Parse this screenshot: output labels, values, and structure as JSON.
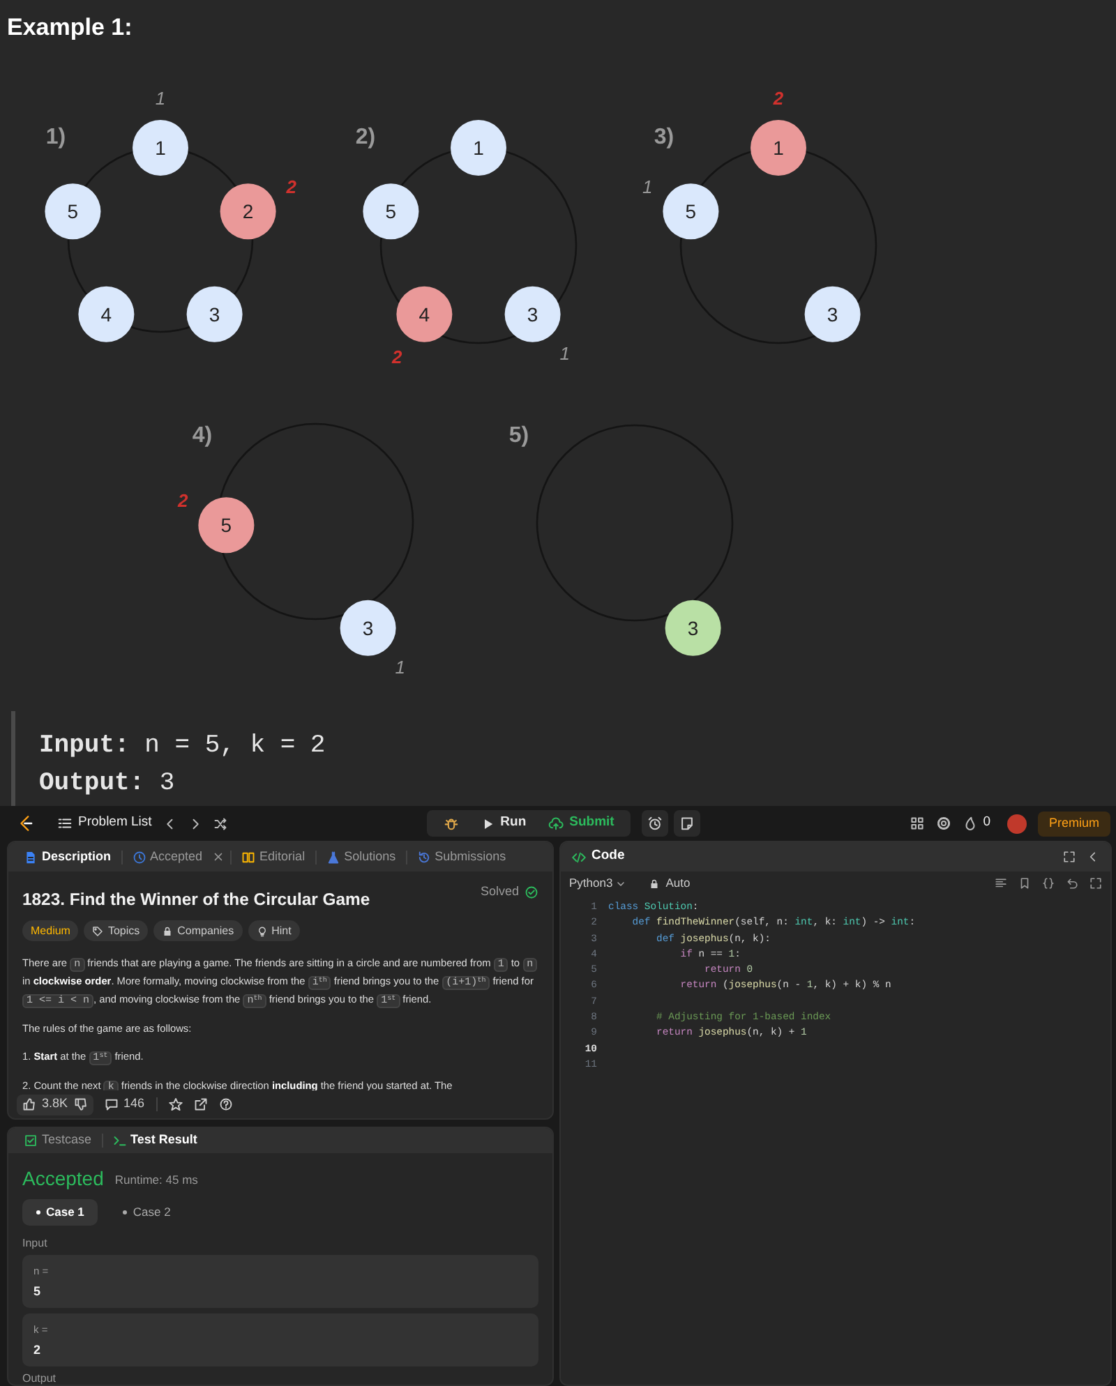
{
  "heading": "Example 1:",
  "diagram": {
    "panels": [
      {
        "label": "1)",
        "nodes": [
          {
            "label": "1",
            "kind": "top",
            "color": "#dae8fc",
            "marker": {
              "text": "1",
              "kind": "start"
            }
          },
          {
            "label": "5",
            "kind": "left",
            "color": "#dae8fc"
          },
          {
            "label": "2",
            "kind": "right",
            "color": "#ea9999",
            "marker": {
              "text": "2",
              "kind": "hit"
            }
          },
          {
            "label": "4",
            "kind": "bottom-left",
            "color": "#dae8fc"
          },
          {
            "label": "3",
            "kind": "bottom-right",
            "color": "#dae8fc"
          }
        ]
      },
      {
        "label": "2)",
        "nodes": [
          {
            "label": "1",
            "kind": "top",
            "color": "#dae8fc"
          },
          {
            "label": "5",
            "kind": "left",
            "color": "#dae8fc"
          },
          {
            "label": "4",
            "kind": "bottom-left",
            "color": "#ea9999",
            "marker": {
              "text": "2",
              "kind": "hit"
            }
          },
          {
            "label": "3",
            "kind": "bottom-right",
            "color": "#dae8fc",
            "marker": {
              "text": "1",
              "kind": "start"
            }
          }
        ]
      },
      {
        "label": "3)",
        "nodes": [
          {
            "label": "1",
            "kind": "top",
            "color": "#ea9999",
            "marker": {
              "text": "2",
              "kind": "hit"
            }
          },
          {
            "label": "5",
            "kind": "left",
            "color": "#dae8fc",
            "marker": {
              "text": "1",
              "kind": "start"
            }
          },
          {
            "label": "3",
            "kind": "bottom-right",
            "color": "#dae8fc"
          }
        ]
      },
      {
        "label": "4)",
        "nodes": [
          {
            "label": "5",
            "kind": "left",
            "color": "#ea9999",
            "marker": {
              "text": "2",
              "kind": "hit"
            }
          },
          {
            "label": "3",
            "kind": "bottom-right",
            "color": "#dae8fc",
            "marker": {
              "text": "1",
              "kind": "start"
            }
          }
        ]
      },
      {
        "label": "5)",
        "nodes": [
          {
            "label": "3",
            "kind": "bottom-right",
            "color": "#b9e0a5"
          }
        ]
      }
    ]
  },
  "example": {
    "input": "**Input:** n = 5, k = 2",
    "output": "**Output:** 3"
  },
  "navbar": {
    "problem_list": "Problem List",
    "run": "Run",
    "submit": "Submit",
    "streak": "0",
    "premium": "Premium"
  },
  "description_tabs": [
    {
      "label": "Description",
      "selected": true,
      "closable": false
    },
    {
      "label": "Accepted",
      "selected": false,
      "closable": true
    },
    {
      "label": "Editorial",
      "selected": false,
      "closable": false
    },
    {
      "label": "Solutions",
      "selected": false,
      "closable": false
    },
    {
      "label": "Submissions",
      "selected": false,
      "closable": false
    }
  ],
  "problem": {
    "title": "1823. Find the Winner of the Circular Game",
    "status": "Solved",
    "tags": [
      {
        "label": "Medium",
        "kind": "difficulty"
      },
      {
        "label": "Topics",
        "kind": "topics"
      },
      {
        "label": "Companies",
        "kind": "companies"
      },
      {
        "label": "Hint",
        "kind": "hint"
      }
    ],
    "paragraphs": [
      [
        "There are ",
        {
          "code": "n"
        },
        " friends that are playing a game. The friends are sitting in a circle and are numbered from ",
        {
          "code": "1"
        },
        " to ",
        {
          "code": "n"
        },
        " in **clockwise order**. More formally, moving clockwise from the ",
        {
          "code": "i$^{th}$"
        },
        " friend brings you to the ",
        {
          "code": "(i+1)$^{th}$"
        },
        " friend for ",
        {
          "code": "1 <= i < n"
        },
        ", and moving clockwise from the ",
        {
          "code": "n$^{th}$"
        },
        " friend brings you to the ",
        {
          "code": "1$^{st}$"
        },
        " friend."
      ],
      [
        "The rules of the game are as follows:"
      ],
      [
        "1. **Start** at the ",
        {
          "code": "1$^{st}$"
        },
        " friend."
      ],
      [
        "2. Count the next ",
        {
          "code": "k"
        },
        " friends in the clockwise direction **including** the friend you started at. The"
      ]
    ],
    "likes": "3.8K",
    "comments": "146"
  },
  "test_tabs": [
    {
      "label": "Testcase",
      "selected": false
    },
    {
      "label": "Test Result",
      "selected": true
    }
  ],
  "result": {
    "verdict": "Accepted",
    "runtime": "Runtime: 45 ms",
    "cases": [
      {
        "label": "Case 1",
        "selected": true
      },
      {
        "label": "Case 2",
        "selected": false
      }
    ],
    "input_label": "Input",
    "inputs": [
      {
        "name": "n =",
        "value": "5"
      },
      {
        "name": "k =",
        "value": "2"
      }
    ],
    "output_label": "Output"
  },
  "code": {
    "title": "Code",
    "language": "Python3",
    "mode": "Auto",
    "lines": [
      {
        "number": "1",
        "current": false,
        "tokens": [
          {
            "t": "class",
            "kind": "kw"
          },
          {
            "t": " Solution",
            "kind": "type"
          },
          {
            "t": ":",
            "kind": "plain"
          }
        ]
      },
      {
        "number": "2",
        "current": false,
        "tokens": [
          {
            "t": "    def",
            "kind": "kw"
          },
          {
            "t": " findTheWinner",
            "kind": "fn"
          },
          {
            "t": "(self, n: ",
            "kind": "plain"
          },
          {
            "t": "int",
            "kind": "type"
          },
          {
            "t": ", k: ",
            "kind": "plain"
          },
          {
            "t": "int",
            "kind": "type"
          },
          {
            "t": ") -> ",
            "kind": "plain"
          },
          {
            "t": "int",
            "kind": "type"
          },
          {
            "t": ":",
            "kind": "plain"
          }
        ]
      },
      {
        "number": "3",
        "current": false,
        "tokens": [
          {
            "t": "        def",
            "kind": "kw"
          },
          {
            "t": " josephus",
            "kind": "fn"
          },
          {
            "t": "(n, k):",
            "kind": "plain"
          }
        ]
      },
      {
        "number": "4",
        "current": false,
        "tokens": [
          {
            "t": "            if",
            "kind": "ctl"
          },
          {
            "t": " n == ",
            "kind": "plain"
          },
          {
            "t": "1",
            "kind": "num"
          },
          {
            "t": ":",
            "kind": "plain"
          }
        ]
      },
      {
        "number": "5",
        "current": false,
        "tokens": [
          {
            "t": "                return",
            "kind": "ctl"
          },
          {
            "t": " 0",
            "kind": "num"
          }
        ]
      },
      {
        "number": "6",
        "current": false,
        "tokens": [
          {
            "t": "            return",
            "kind": "ctl"
          },
          {
            "t": " (",
            "kind": "plain"
          },
          {
            "t": "josephus",
            "kind": "fn"
          },
          {
            "t": "(n - ",
            "kind": "plain"
          },
          {
            "t": "1",
            "kind": "num"
          },
          {
            "t": ", k) + k) % n",
            "kind": "plain"
          }
        ]
      },
      {
        "number": "7",
        "current": false
      },
      {
        "number": "8",
        "current": false,
        "tokens": [
          {
            "t": "        # Adjusting for 1-based index",
            "kind": "cmt"
          }
        ]
      },
      {
        "number": "9",
        "current": false,
        "tokens": [
          {
            "t": "        return",
            "kind": "ctl"
          },
          {
            "t": " josephus",
            "kind": "fn"
          },
          {
            "t": "(n, k) + ",
            "kind": "plain"
          },
          {
            "t": "1",
            "kind": "num"
          }
        ]
      },
      {
        "number": "10",
        "current": true
      },
      {
        "number": "11",
        "current": false
      }
    ]
  }
}
